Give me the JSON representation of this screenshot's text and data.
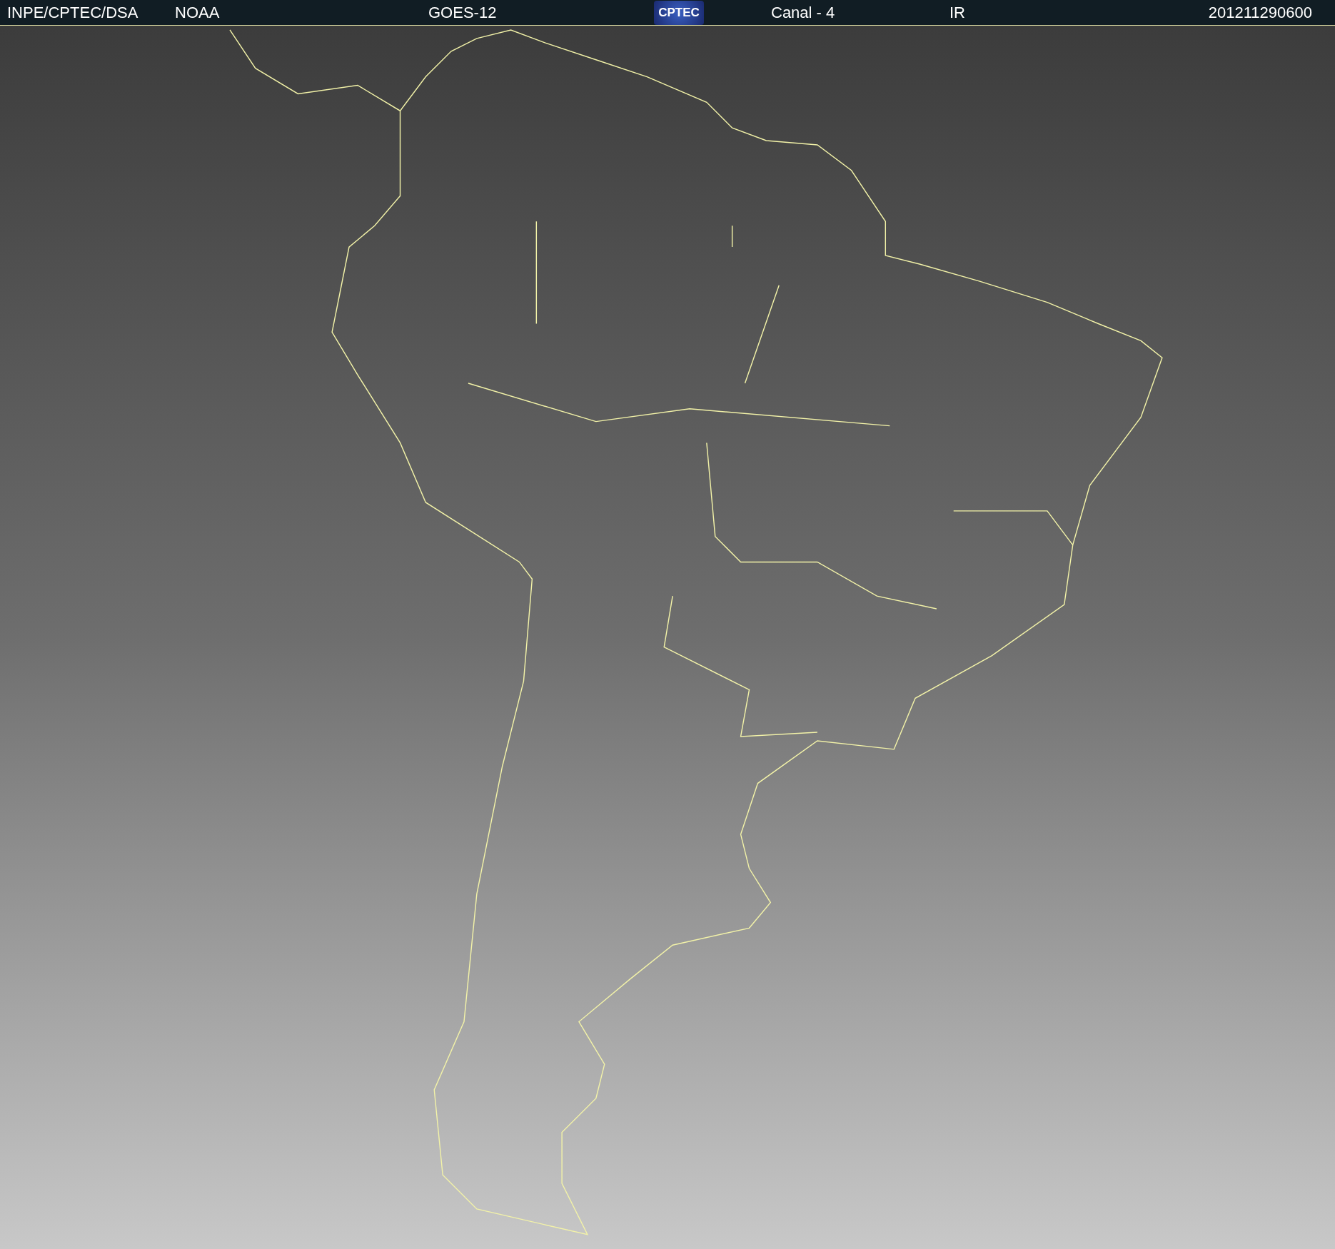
{
  "header": {
    "items": [
      {
        "kind": "text",
        "text": "INPE/CPTEC/DSA"
      },
      {
        "kind": "text",
        "text": "NOAA"
      },
      {
        "kind": "text",
        "text": "GOES-12"
      },
      {
        "kind": "logo",
        "text": "CPTEC"
      },
      {
        "kind": "text",
        "text": "Canal - 4"
      },
      {
        "kind": "text",
        "text": "IR"
      },
      {
        "kind": "text",
        "text": "201211290600"
      }
    ]
  }
}
